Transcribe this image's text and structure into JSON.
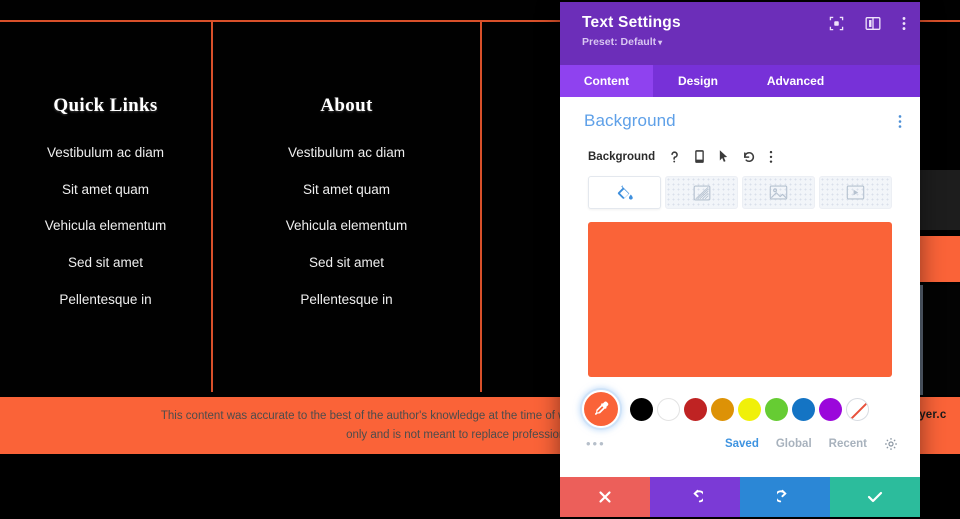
{
  "page": {
    "columns": [
      {
        "title": "Quick Links",
        "links": [
          "Vestibulum ac diam",
          "Sit amet quam",
          "Vehicula elementum",
          "Sed sit amet",
          "Pellentesque in"
        ]
      },
      {
        "title": "About",
        "links": [
          "Vestibulum ac diam",
          "Sit amet quam",
          "Vehicula elementum",
          "Sed sit amet",
          "Pellentesque in"
        ]
      }
    ],
    "disclaimer_line1": "This content was accurate to the best of the author's knowledge at the time of writing. It is intended for informational purposes",
    "disclaimer_line2": "only and is not meant to replace professional advice.",
    "url_fragment": "vayer.c",
    "accent_orange": "#fa6338",
    "rule_color": "#d8502a"
  },
  "panel": {
    "title": "Text Settings",
    "preset": "Preset: Default",
    "preset_caret": "▾",
    "header_icons": [
      {
        "name": "focus-frame-icon"
      },
      {
        "name": "panel-layout-icon"
      },
      {
        "name": "kebab-menu-icon"
      }
    ],
    "tabs": [
      {
        "label": "Content",
        "active": true
      },
      {
        "label": "Design",
        "active": false
      },
      {
        "label": "Advanced",
        "active": false
      }
    ],
    "section": {
      "title": "Background",
      "kebab": "⋮"
    },
    "field": {
      "label": "Background",
      "icons": [
        "help-icon",
        "responsive-icon",
        "hover-icon",
        "reset-icon",
        "options-kebab-icon"
      ]
    },
    "background_types": [
      {
        "name": "color-fill-tab",
        "active": true
      },
      {
        "name": "gradient-tab",
        "active": false
      },
      {
        "name": "image-tab",
        "active": false
      },
      {
        "name": "video-tab",
        "active": false
      }
    ],
    "selected_color": "#fa6338",
    "palette": [
      {
        "name": "black",
        "hex": "#000000"
      },
      {
        "name": "white",
        "hex": "#ffffff"
      },
      {
        "name": "red",
        "hex": "#bf2323"
      },
      {
        "name": "orange",
        "hex": "#dd9206"
      },
      {
        "name": "yellow",
        "hex": "#f0f009"
      },
      {
        "name": "green",
        "hex": "#66cc33"
      },
      {
        "name": "blue",
        "hex": "#1474c4"
      },
      {
        "name": "purple",
        "hex": "#9b07db"
      },
      {
        "name": "none",
        "hex": "transparent"
      }
    ],
    "palette_more": "•••",
    "palette_tabs": [
      {
        "label": "Saved",
        "active": true
      },
      {
        "label": "Global",
        "active": false
      },
      {
        "label": "Recent",
        "active": false
      }
    ],
    "footer_buttons": [
      {
        "name": "cancel-button",
        "glyph": "✖",
        "color": "#ec5f5a"
      },
      {
        "name": "undo-button",
        "glyph": "↺",
        "color": "#7b3ad6"
      },
      {
        "name": "redo-button",
        "glyph": "↻",
        "color": "#2b87d6"
      },
      {
        "name": "save-button",
        "glyph": "✔",
        "color": "#2cbc9c"
      }
    ]
  }
}
